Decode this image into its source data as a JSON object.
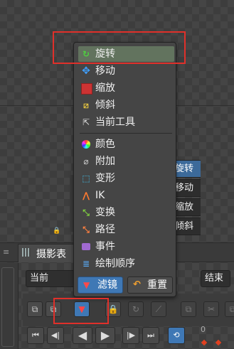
{
  "menu": {
    "items": [
      {
        "label": "旋转",
        "icon": "rotate-icon",
        "glyph": "↻"
      },
      {
        "label": "移动",
        "icon": "move-icon",
        "glyph": "✥"
      },
      {
        "label": "缩放",
        "icon": "scale-icon",
        "glyph": ""
      },
      {
        "label": "倾斜",
        "icon": "skew-icon",
        "glyph": "⧄"
      },
      {
        "label": "当前工具",
        "icon": "current-tool-icon",
        "glyph": "⇱"
      },
      {
        "label": "颜色",
        "icon": "color-wheel-icon",
        "glyph": ""
      },
      {
        "label": "附加",
        "icon": "attachment-icon",
        "glyph": "⌀"
      },
      {
        "label": "变形",
        "icon": "deform-icon",
        "glyph": "⬚"
      },
      {
        "label": "IK",
        "icon": "ik-icon",
        "glyph": "⋀"
      },
      {
        "label": "变换",
        "icon": "transform-constraint-icon",
        "glyph": "⤡"
      },
      {
        "label": "路径",
        "icon": "path-icon",
        "glyph": "⤡"
      },
      {
        "label": "事件",
        "icon": "event-icon",
        "glyph": ""
      },
      {
        "label": "绘制顺序",
        "icon": "draw-order-icon",
        "glyph": "≣"
      }
    ],
    "filter_button": {
      "label": "滤镜",
      "glyph": "▼"
    },
    "reset_button": {
      "label": "重置",
      "glyph": "↶"
    }
  },
  "right_list": [
    "旋转",
    "移动",
    "缩放",
    "倾斜"
  ],
  "panel": {
    "tab_label": "摄影表",
    "grip": "≡",
    "dropdown_left": "当前",
    "dropdown_right": "结束",
    "dropdown_arrow": "▼"
  },
  "toolbar": {
    "glyphs": [
      "⧉",
      "⧉",
      "▼",
      "🔒",
      "↻",
      "⟋",
      "⧉",
      "✂",
      "⧉"
    ]
  },
  "playback": {
    "glyphs": [
      "⏮",
      "◀|",
      "◀",
      "▶",
      "|▶",
      "⏭",
      "⟲"
    ],
    "ruler_value": "0"
  },
  "colors": {
    "accent": "#3f78b5",
    "highlight": "#62735e",
    "annotation": "#e0302a"
  }
}
